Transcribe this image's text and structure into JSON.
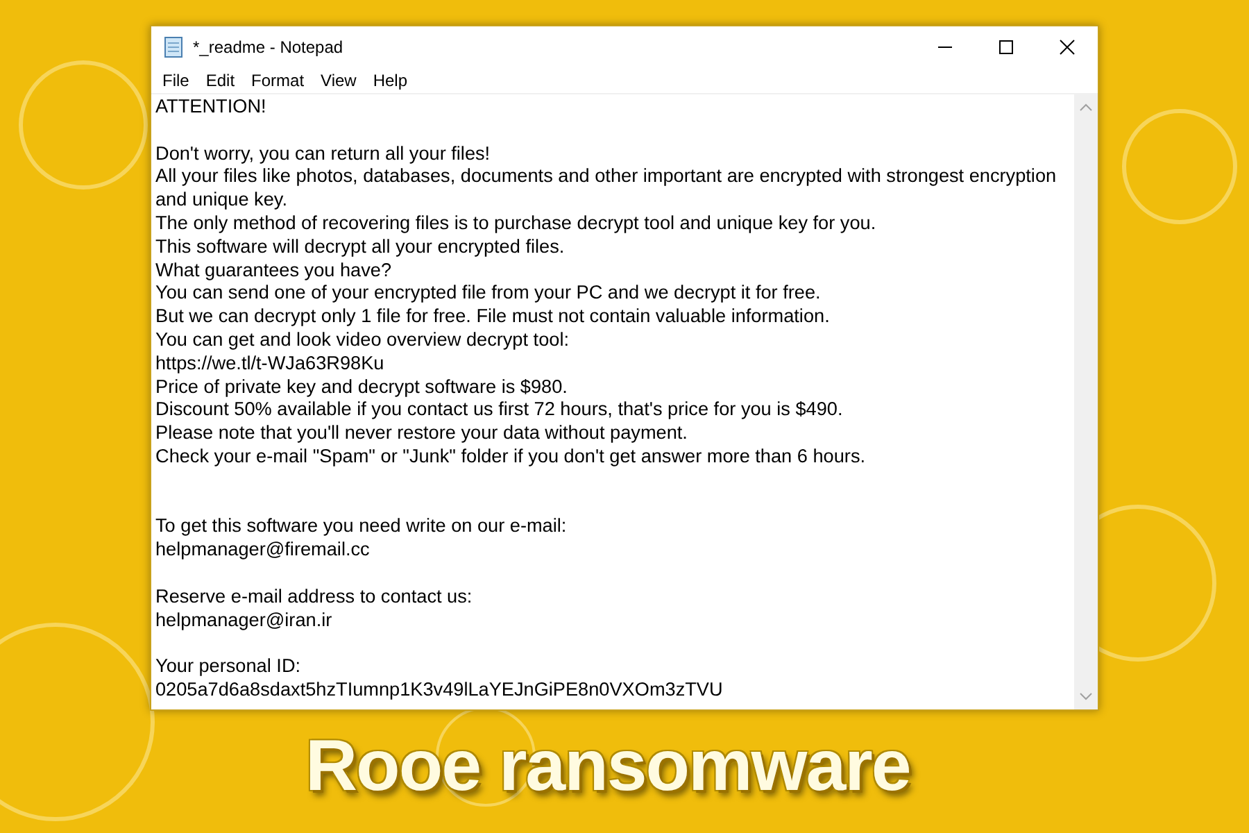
{
  "window": {
    "title": "*_readme - Notepad"
  },
  "menu": [
    {
      "label": "File"
    },
    {
      "label": "Edit"
    },
    {
      "label": "Format"
    },
    {
      "label": "View"
    },
    {
      "label": "Help"
    }
  ],
  "document": {
    "lines": [
      {
        "kind": "text",
        "text": "ATTENTION!"
      },
      {
        "kind": "blank"
      },
      {
        "kind": "text",
        "text": "Don't worry, you can return all your files!"
      },
      {
        "kind": "text",
        "text": "All your files like photos, databases, documents and other important are encrypted with strongest encryption and unique key."
      },
      {
        "kind": "text",
        "text": "The only method of recovering files is to purchase decrypt tool and unique key for you."
      },
      {
        "kind": "text",
        "text": "This software will decrypt all your encrypted files."
      },
      {
        "kind": "text",
        "text": "What guarantees you have?"
      },
      {
        "kind": "text",
        "text": "You can send one of your encrypted file from your PC and we decrypt it for free."
      },
      {
        "kind": "text",
        "text": "But we can decrypt only 1 file for free. File must not contain valuable information."
      },
      {
        "kind": "text",
        "text": "You can get and look video overview decrypt tool:"
      },
      {
        "kind": "text",
        "text": "https://we.tl/t-WJa63R98Ku"
      },
      {
        "kind": "text",
        "text": "Price of private key and decrypt software is $980."
      },
      {
        "kind": "text",
        "text": "Discount 50% available if you contact us first 72 hours, that's price for you is $490."
      },
      {
        "kind": "text",
        "text": "Please note that you'll never restore your data without payment."
      },
      {
        "kind": "text",
        "text": "Check your e-mail \"Spam\" or \"Junk\" folder if you don't get answer more than 6 hours."
      },
      {
        "kind": "blank"
      },
      {
        "kind": "blank"
      },
      {
        "kind": "text",
        "text": "To get this software you need write on our e-mail:"
      },
      {
        "kind": "text",
        "text": "helpmanager@firemail.cc"
      },
      {
        "kind": "blank"
      },
      {
        "kind": "text",
        "text": "Reserve e-mail address to contact us:"
      },
      {
        "kind": "text",
        "text": "helpmanager@iran.ir"
      },
      {
        "kind": "blank"
      },
      {
        "kind": "text",
        "text": "Your personal ID:"
      },
      {
        "kind": "text",
        "text": "0205a7d6a8sdaxt5hzTIumnp1K3v49lLaYEJnGiPE8n0VXOm3zTVU"
      }
    ]
  },
  "caption": "Rooe ransomware"
}
